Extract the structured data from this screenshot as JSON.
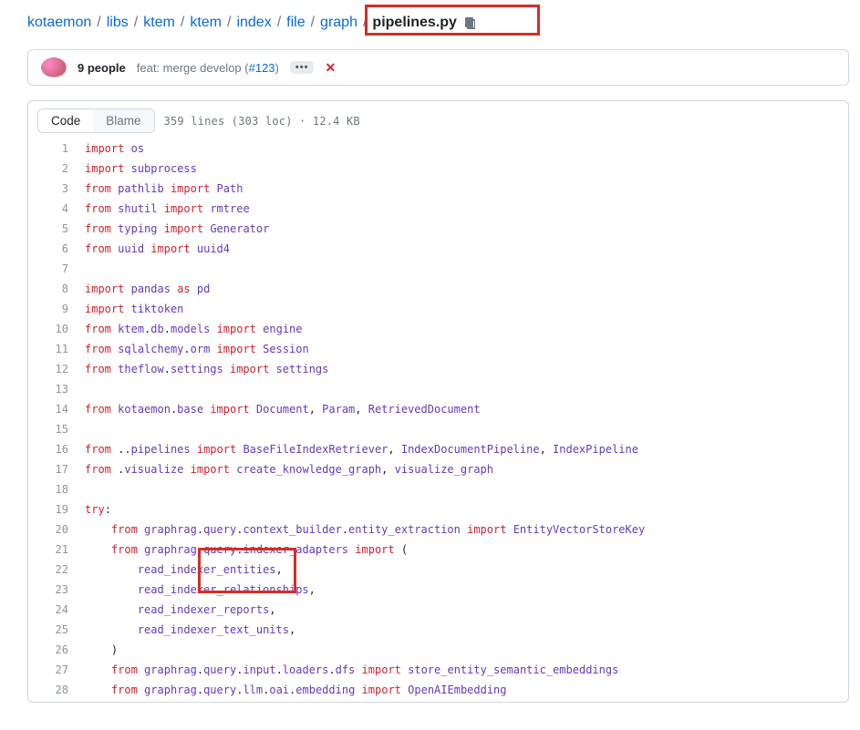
{
  "breadcrumb": {
    "parts": [
      "kotaemon",
      "libs",
      "ktem",
      "ktem",
      "index",
      "file",
      "graph"
    ],
    "final": "pipelines.py",
    "sep": "/"
  },
  "meta": {
    "people_label": "9 people",
    "commit_prefix": "feat: merge develop (",
    "commit_link": "#123",
    "commit_suffix": ")",
    "ellipsis": "•••"
  },
  "header": {
    "code_btn": "Code",
    "blame_btn": "Blame",
    "stats": "359 lines (303 loc) · 12.4 KB"
  },
  "code": {
    "lines": [
      [
        1,
        [
          [
            "kw",
            "import"
          ],
          [
            "plain",
            " "
          ],
          [
            "mod",
            "os"
          ]
        ]
      ],
      [
        2,
        [
          [
            "kw",
            "import"
          ],
          [
            "plain",
            " "
          ],
          [
            "mod",
            "subprocess"
          ]
        ]
      ],
      [
        3,
        [
          [
            "kw",
            "from"
          ],
          [
            "plain",
            " "
          ],
          [
            "mod",
            "pathlib"
          ],
          [
            "plain",
            " "
          ],
          [
            "kw",
            "import"
          ],
          [
            "plain",
            " "
          ],
          [
            "mod",
            "Path"
          ]
        ]
      ],
      [
        4,
        [
          [
            "kw",
            "from"
          ],
          [
            "plain",
            " "
          ],
          [
            "mod",
            "shutil"
          ],
          [
            "plain",
            " "
          ],
          [
            "kw",
            "import"
          ],
          [
            "plain",
            " "
          ],
          [
            "mod",
            "rmtree"
          ]
        ]
      ],
      [
        5,
        [
          [
            "kw",
            "from"
          ],
          [
            "plain",
            " "
          ],
          [
            "mod",
            "typing"
          ],
          [
            "plain",
            " "
          ],
          [
            "kw",
            "import"
          ],
          [
            "plain",
            " "
          ],
          [
            "mod",
            "Generator"
          ]
        ]
      ],
      [
        6,
        [
          [
            "kw",
            "from"
          ],
          [
            "plain",
            " "
          ],
          [
            "mod",
            "uuid"
          ],
          [
            "plain",
            " "
          ],
          [
            "kw",
            "import"
          ],
          [
            "plain",
            " "
          ],
          [
            "mod",
            "uuid4"
          ]
        ]
      ],
      [
        7,
        []
      ],
      [
        8,
        [
          [
            "kw",
            "import"
          ],
          [
            "plain",
            " "
          ],
          [
            "mod",
            "pandas"
          ],
          [
            "plain",
            " "
          ],
          [
            "kw",
            "as"
          ],
          [
            "plain",
            " "
          ],
          [
            "mod",
            "pd"
          ]
        ]
      ],
      [
        9,
        [
          [
            "kw",
            "import"
          ],
          [
            "plain",
            " "
          ],
          [
            "mod",
            "tiktoken"
          ]
        ]
      ],
      [
        10,
        [
          [
            "kw",
            "from"
          ],
          [
            "plain",
            " "
          ],
          [
            "mod",
            "ktem"
          ],
          [
            "plain",
            "."
          ],
          [
            "mod",
            "db"
          ],
          [
            "plain",
            "."
          ],
          [
            "mod",
            "models"
          ],
          [
            "plain",
            " "
          ],
          [
            "kw",
            "import"
          ],
          [
            "plain",
            " "
          ],
          [
            "mod",
            "engine"
          ]
        ]
      ],
      [
        11,
        [
          [
            "kw",
            "from"
          ],
          [
            "plain",
            " "
          ],
          [
            "mod",
            "sqlalchemy"
          ],
          [
            "plain",
            "."
          ],
          [
            "mod",
            "orm"
          ],
          [
            "plain",
            " "
          ],
          [
            "kw",
            "import"
          ],
          [
            "plain",
            " "
          ],
          [
            "mod",
            "Session"
          ]
        ]
      ],
      [
        12,
        [
          [
            "kw",
            "from"
          ],
          [
            "plain",
            " "
          ],
          [
            "mod",
            "theflow"
          ],
          [
            "plain",
            "."
          ],
          [
            "mod",
            "settings"
          ],
          [
            "plain",
            " "
          ],
          [
            "kw",
            "import"
          ],
          [
            "plain",
            " "
          ],
          [
            "mod",
            "settings"
          ]
        ]
      ],
      [
        13,
        []
      ],
      [
        14,
        [
          [
            "kw",
            "from"
          ],
          [
            "plain",
            " "
          ],
          [
            "mod",
            "kotaemon"
          ],
          [
            "plain",
            "."
          ],
          [
            "mod",
            "base"
          ],
          [
            "plain",
            " "
          ],
          [
            "kw",
            "import"
          ],
          [
            "plain",
            " "
          ],
          [
            "mod",
            "Document"
          ],
          [
            "plain",
            ", "
          ],
          [
            "mod",
            "Param"
          ],
          [
            "plain",
            ", "
          ],
          [
            "mod",
            "RetrievedDocument"
          ]
        ]
      ],
      [
        15,
        []
      ],
      [
        16,
        [
          [
            "kw",
            "from"
          ],
          [
            "plain",
            " .."
          ],
          [
            "mod",
            "pipelines"
          ],
          [
            "plain",
            " "
          ],
          [
            "kw",
            "import"
          ],
          [
            "plain",
            " "
          ],
          [
            "mod",
            "BaseFileIndexRetriever"
          ],
          [
            "plain",
            ", "
          ],
          [
            "mod",
            "IndexDocumentPipeline"
          ],
          [
            "plain",
            ", "
          ],
          [
            "mod",
            "IndexPipeline"
          ]
        ]
      ],
      [
        17,
        [
          [
            "kw",
            "from"
          ],
          [
            "plain",
            " ."
          ],
          [
            "mod",
            "visualize"
          ],
          [
            "plain",
            " "
          ],
          [
            "kw",
            "import"
          ],
          [
            "plain",
            " "
          ],
          [
            "mod",
            "create_knowledge_graph"
          ],
          [
            "plain",
            ", "
          ],
          [
            "mod",
            "visualize_graph"
          ]
        ]
      ],
      [
        18,
        []
      ],
      [
        19,
        [
          [
            "kw",
            "try"
          ],
          [
            "plain",
            ":"
          ]
        ]
      ],
      [
        20,
        [
          [
            "plain",
            "    "
          ],
          [
            "kw",
            "from"
          ],
          [
            "plain",
            " "
          ],
          [
            "mod",
            "graphrag"
          ],
          [
            "plain",
            "."
          ],
          [
            "mod",
            "query"
          ],
          [
            "plain",
            "."
          ],
          [
            "mod",
            "context_builder"
          ],
          [
            "plain",
            "."
          ],
          [
            "mod",
            "entity_extraction"
          ],
          [
            "plain",
            " "
          ],
          [
            "kw",
            "import"
          ],
          [
            "plain",
            " "
          ],
          [
            "mod",
            "EntityVectorStoreKey"
          ]
        ]
      ],
      [
        21,
        [
          [
            "plain",
            "    "
          ],
          [
            "kw",
            "from"
          ],
          [
            "plain",
            " "
          ],
          [
            "mod",
            "graphrag"
          ],
          [
            "plain",
            "."
          ],
          [
            "mod",
            "query"
          ],
          [
            "plain",
            "."
          ],
          [
            "mod",
            "indexer_adapters"
          ],
          [
            "plain",
            " "
          ],
          [
            "kw",
            "import"
          ],
          [
            "plain",
            " ("
          ]
        ]
      ],
      [
        22,
        [
          [
            "plain",
            "        "
          ],
          [
            "mod",
            "read_indexer_entities"
          ],
          [
            "plain",
            ","
          ]
        ]
      ],
      [
        23,
        [
          [
            "plain",
            "        "
          ],
          [
            "mod",
            "read_indexer_relationships"
          ],
          [
            "plain",
            ","
          ]
        ]
      ],
      [
        24,
        [
          [
            "plain",
            "        "
          ],
          [
            "mod",
            "read_indexer_reports"
          ],
          [
            "plain",
            ","
          ]
        ]
      ],
      [
        25,
        [
          [
            "plain",
            "        "
          ],
          [
            "mod",
            "read_indexer_text_units"
          ],
          [
            "plain",
            ","
          ]
        ]
      ],
      [
        26,
        [
          [
            "plain",
            "    )"
          ]
        ]
      ],
      [
        27,
        [
          [
            "plain",
            "    "
          ],
          [
            "kw",
            "from"
          ],
          [
            "plain",
            " "
          ],
          [
            "mod",
            "graphrag"
          ],
          [
            "plain",
            "."
          ],
          [
            "mod",
            "query"
          ],
          [
            "plain",
            "."
          ],
          [
            "mod",
            "input"
          ],
          [
            "plain",
            "."
          ],
          [
            "mod",
            "loaders"
          ],
          [
            "plain",
            "."
          ],
          [
            "mod",
            "dfs"
          ],
          [
            "plain",
            " "
          ],
          [
            "kw",
            "import"
          ],
          [
            "plain",
            " "
          ],
          [
            "mod",
            "store_entity_semantic_embeddings"
          ]
        ]
      ],
      [
        28,
        [
          [
            "plain",
            "    "
          ],
          [
            "kw",
            "from"
          ],
          [
            "plain",
            " "
          ],
          [
            "mod",
            "graphrag"
          ],
          [
            "plain",
            "."
          ],
          [
            "mod",
            "query"
          ],
          [
            "plain",
            "."
          ],
          [
            "mod",
            "llm"
          ],
          [
            "plain",
            "."
          ],
          [
            "mod",
            "oai"
          ],
          [
            "plain",
            "."
          ],
          [
            "mod",
            "embedding"
          ],
          [
            "plain",
            " "
          ],
          [
            "kw",
            "import"
          ],
          [
            "plain",
            " "
          ],
          [
            "mod",
            "OpenAIEmbedding"
          ]
        ]
      ]
    ]
  }
}
